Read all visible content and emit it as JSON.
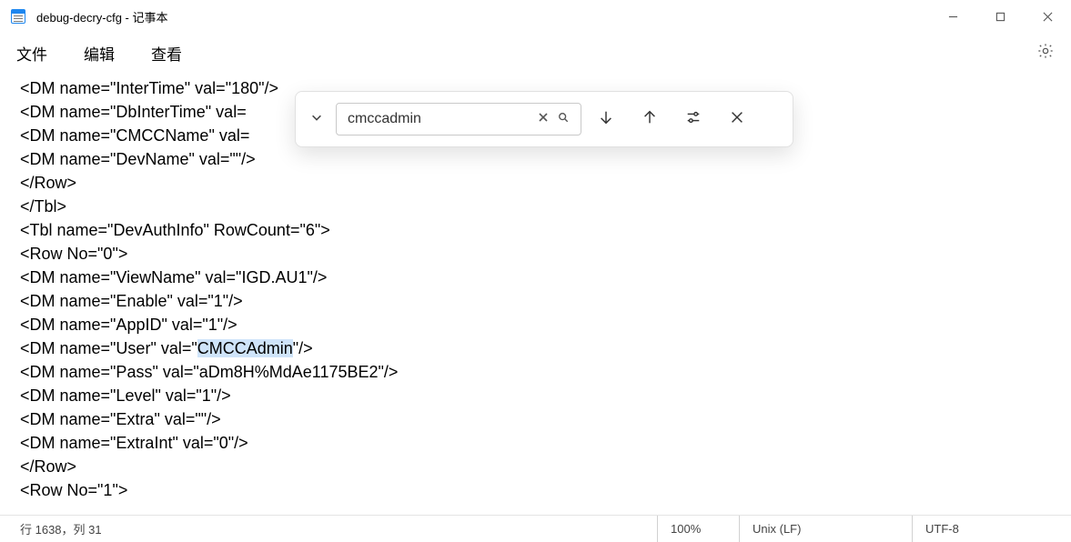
{
  "window": {
    "title": "debug-decry-cfg - 记事本"
  },
  "menu": {
    "file": "文件",
    "edit": "编辑",
    "view": "查看"
  },
  "find": {
    "value": "cmccadmin"
  },
  "content": {
    "l1": "<DM name=\"InterTime\" val=\"180\"/>",
    "l2": "<DM name=\"DbInterTime\" val=",
    "l3": "<DM name=\"CMCCName\" val=",
    "l4": "<DM name=\"DevName\" val=\"\"/>",
    "l5": "</Row>",
    "l6": "</Tbl>",
    "l7": "<Tbl name=\"DevAuthInfo\" RowCount=\"6\">",
    "l8": "<Row No=\"0\">",
    "l9": "<DM name=\"ViewName\" val=\"IGD.AU1\"/>",
    "l10": "<DM name=\"Enable\" val=\"1\"/>",
    "l11": "<DM name=\"AppID\" val=\"1\"/>",
    "l12a": "<DM name=\"User\" val=\"",
    "l12b": "CMCCAdmin",
    "l12c": "\"/>",
    "l13": "<DM name=\"Pass\" val=\"aDm8H%MdAe1175BE2\"/>",
    "l14": "<DM name=\"Level\" val=\"1\"/>",
    "l15": "<DM name=\"Extra\" val=\"\"/>",
    "l16": "<DM name=\"ExtraInt\" val=\"0\"/>",
    "l17": "</Row>",
    "l18": "<Row No=\"1\">"
  },
  "status": {
    "pos": "行 1638，列 31",
    "zoom": "100%",
    "eol": "Unix (LF)",
    "enc": "UTF-8"
  }
}
